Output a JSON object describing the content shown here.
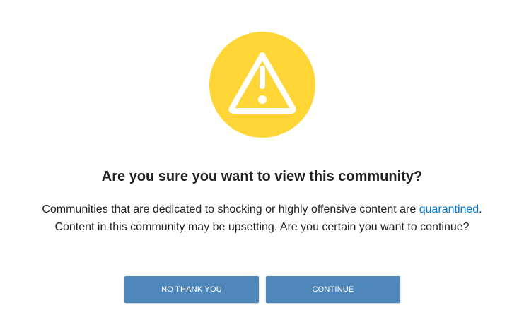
{
  "icon": {
    "name": "warning-triangle-icon",
    "circle_color": "#ffd635",
    "glyph_color": "#ffffff"
  },
  "dialog": {
    "title": "Are you sure you want to view this community?",
    "message_before_link": "Communities that are dedicated to shocking or highly offensive content are ",
    "link_text": "quarantined",
    "message_after_link": ". Content in this community may be upsetting. Are you certain you want to continue?"
  },
  "buttons": {
    "decline_label": "NO THANK YOU",
    "continue_label": "CONTINUE"
  },
  "colors": {
    "button": "#5087bb",
    "link": "#0079d3"
  }
}
